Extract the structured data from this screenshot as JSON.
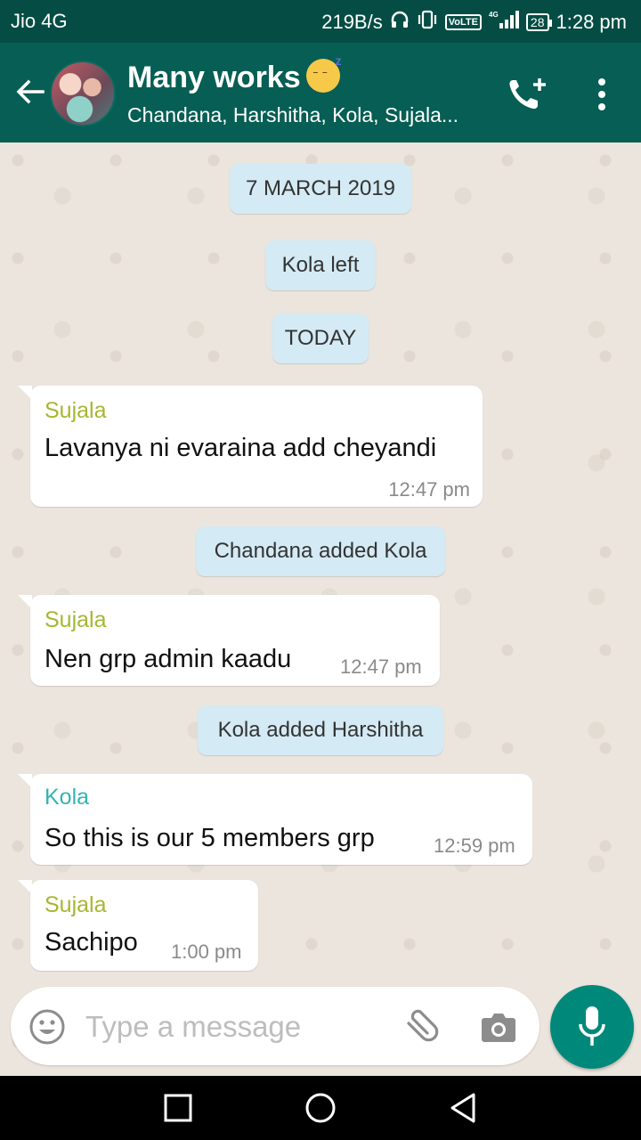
{
  "status_bar": {
    "carrier": "Jio 4G",
    "speed": "219B/s",
    "network": "4G",
    "volte": "VoLTE",
    "battery": "28",
    "time": "1:28 pm"
  },
  "header": {
    "title": "Many works",
    "members": "Chandana, Harshitha, Kola, Sujala..."
  },
  "messages": {
    "date_march": "7 MARCH 2019",
    "kola_left": "Kola left",
    "today": "TODAY",
    "m1": {
      "sender": "Sujala",
      "text": "Lavanya ni evaraina add cheyandi",
      "time": "12:47 pm"
    },
    "chandana_added": "Chandana added Kola",
    "m2": {
      "sender": "Sujala",
      "text": "Nen grp admin kaadu",
      "time": "12:47 pm"
    },
    "kola_added": "Kola added Harshitha",
    "m3": {
      "sender": "Kola",
      "text": "So this is our 5 members grp",
      "time": "12:59 pm"
    },
    "m4": {
      "sender": "Sujala",
      "text": "Sachipo",
      "time": "1:00 pm"
    }
  },
  "input": {
    "placeholder": "Type a message"
  },
  "colors": {
    "header": "#075e54",
    "status_bar": "#054d44",
    "sender_sujala": "#a5b72f",
    "sender_kola": "#35b3b3",
    "system_bubble": "#d4eaf4",
    "mic_button": "#00897b"
  }
}
